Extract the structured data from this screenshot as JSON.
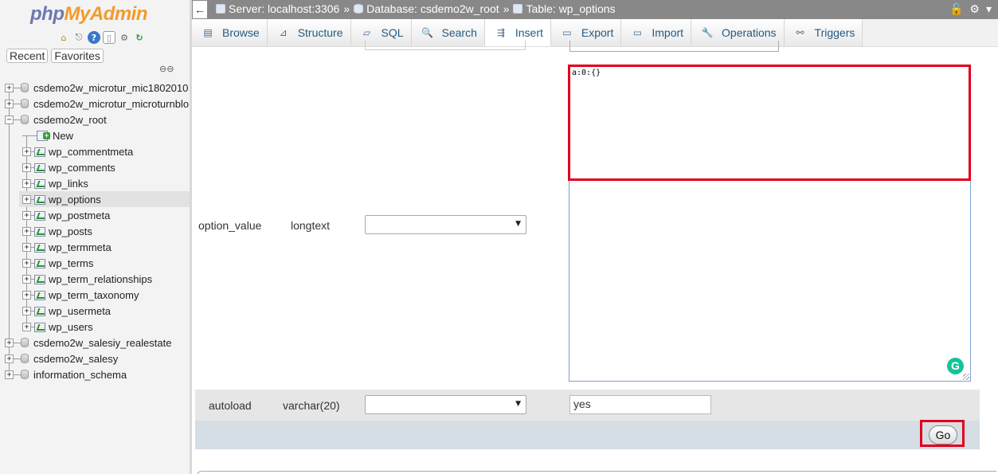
{
  "app": {
    "logo_php": "php",
    "logo_admin": "MyAdmin"
  },
  "nav": {
    "tabs": [
      "Recent",
      "Favorites"
    ],
    "icons": [
      "home-icon",
      "exit-icon",
      "help-icon",
      "documentation-icon",
      "settings-icon",
      "reload-icon",
      "link-icon"
    ],
    "tree": {
      "databases": [
        {
          "name": "csdemo2w_microtur_mic1802010",
          "expanded": false
        },
        {
          "name": "csdemo2w_microtur_microturnblo",
          "expanded": false
        },
        {
          "name": "csdemo2w_root",
          "expanded": true
        }
      ],
      "new_label": "New",
      "tables": [
        "wp_commentmeta",
        "wp_comments",
        "wp_links",
        "wp_options",
        "wp_postmeta",
        "wp_posts",
        "wp_termmeta",
        "wp_terms",
        "wp_term_relationships",
        "wp_term_taxonomy",
        "wp_usermeta",
        "wp_users"
      ],
      "active_table": "wp_options",
      "more_databases": [
        "csdemo2w_salesiy_realestate",
        "csdemo2w_salesy",
        "information_schema"
      ]
    }
  },
  "breadcrumb": {
    "server": "Server: localhost:3306",
    "database": "Database: csdemo2w_root",
    "table": "Table: wp_options",
    "separator": "»"
  },
  "tabs": [
    {
      "label": "Browse",
      "icon": "browse-icon"
    },
    {
      "label": "Structure",
      "icon": "structure-icon"
    },
    {
      "label": "SQL",
      "icon": "sql-icon"
    },
    {
      "label": "Search",
      "icon": "search-icon"
    },
    {
      "label": "Insert",
      "icon": "insert-icon",
      "active": true
    },
    {
      "label": "Export",
      "icon": "export-icon"
    },
    {
      "label": "Import",
      "icon": "import-icon"
    },
    {
      "label": "Operations",
      "icon": "operations-icon"
    },
    {
      "label": "Triggers",
      "icon": "triggers-icon"
    }
  ],
  "form": {
    "rows": [
      {
        "column": "option_value",
        "type": "longtext",
        "function": "",
        "value": "a:0:{}"
      },
      {
        "column": "autoload",
        "type": "varchar(20)",
        "function": "",
        "value": "yes"
      }
    ],
    "go_label": "Go"
  },
  "colors": {
    "highlight": "#e0001a",
    "tab_text": "#235a81",
    "topbar": "#888888",
    "grammarly": "#15c39a"
  }
}
